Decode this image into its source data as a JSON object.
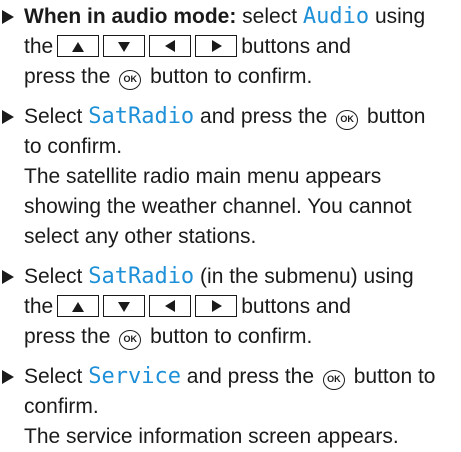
{
  "steps": [
    {
      "lead_bold": "When in audio mode:",
      "select_word": "select",
      "term": "Audio",
      "using": "using",
      "the": "the",
      "buttons_text": "buttons and",
      "press_text": "press the",
      "confirm_text": "button to confirm."
    },
    {
      "select_word": "Select",
      "term": "SatRadio",
      "press_text": "and press the",
      "button_word": "button",
      "confirm_text": "to confirm.",
      "result_lines": [
        "The satellite radio main menu appears",
        "showing the weather channel. You cannot",
        "select any other stations."
      ]
    },
    {
      "select_word": "Select",
      "term": "SatRadio",
      "note": "(in the submenu) using",
      "the": "the",
      "buttons_text": "buttons and",
      "press_text": "press the",
      "confirm_text": "button to confirm."
    },
    {
      "select_word": "Select",
      "term": "Service",
      "press_text": "and press the",
      "button_to": "button to",
      "confirm_text": "confirm.",
      "result_lines": [
        "The service information screen appears."
      ]
    }
  ],
  "icons": {
    "bullet": "triangle-right",
    "nav_buttons": [
      "arrow-up",
      "arrow-down",
      "arrow-left",
      "arrow-right"
    ],
    "ok_label": "OK"
  },
  "colors": {
    "display_text": "#1e90d8",
    "body_text": "#1a1a1a"
  }
}
